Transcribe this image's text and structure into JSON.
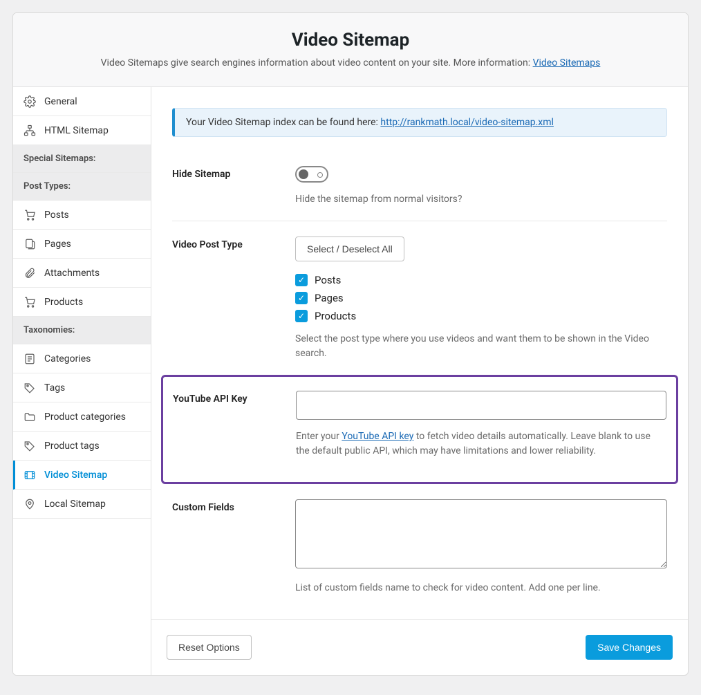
{
  "header": {
    "title": "Video Sitemap",
    "description_prefix": "Video Sitemaps give search engines information about video content on your site. More information: ",
    "link_label": "Video Sitemaps"
  },
  "sidebar": {
    "items": [
      {
        "label": "General",
        "type": "item",
        "icon": "gear-icon"
      },
      {
        "label": "HTML Sitemap",
        "type": "item",
        "icon": "sitemap-icon"
      },
      {
        "label": "Special Sitemaps:",
        "type": "heading"
      },
      {
        "label": "Post Types:",
        "type": "heading"
      },
      {
        "label": "Posts",
        "type": "item",
        "icon": "cart-icon"
      },
      {
        "label": "Pages",
        "type": "item",
        "icon": "page-icon"
      },
      {
        "label": "Attachments",
        "type": "item",
        "icon": "attachment-icon"
      },
      {
        "label": "Products",
        "type": "item",
        "icon": "cart-icon"
      },
      {
        "label": "Taxonomies:",
        "type": "heading"
      },
      {
        "label": "Categories",
        "type": "item",
        "icon": "list-icon"
      },
      {
        "label": "Tags",
        "type": "item",
        "icon": "tag-icon"
      },
      {
        "label": "Product categories",
        "type": "item",
        "icon": "folder-icon"
      },
      {
        "label": "Product tags",
        "type": "item",
        "icon": "tag-icon"
      },
      {
        "label": "Video Sitemap",
        "type": "item",
        "icon": "video-icon",
        "active": true
      },
      {
        "label": "Local Sitemap",
        "type": "item",
        "icon": "pin-icon"
      }
    ]
  },
  "notice": {
    "prefix": "Your Video Sitemap index can be found here: ",
    "url": "http://rankmath.local/video-sitemap.xml"
  },
  "fields": {
    "hide_sitemap": {
      "label": "Hide Sitemap",
      "help": "Hide the sitemap from normal visitors?"
    },
    "video_post_type": {
      "label": "Video Post Type",
      "select_all": "Select / Deselect All",
      "options": [
        "Posts",
        "Pages",
        "Products"
      ],
      "help": "Select the post type where you use videos and want them to be shown in the Video search."
    },
    "youtube_api": {
      "label": "YouTube API Key",
      "value": "",
      "help_prefix": "Enter your ",
      "help_link": "YouTube API key",
      "help_suffix": " to fetch video details automatically. Leave blank to use the default public API, which may have limitations and lower reliability."
    },
    "custom_fields": {
      "label": "Custom Fields",
      "value": "",
      "help": "List of custom fields name to check for video content. Add one per line."
    }
  },
  "footer": {
    "reset": "Reset Options",
    "save": "Save Changes"
  }
}
